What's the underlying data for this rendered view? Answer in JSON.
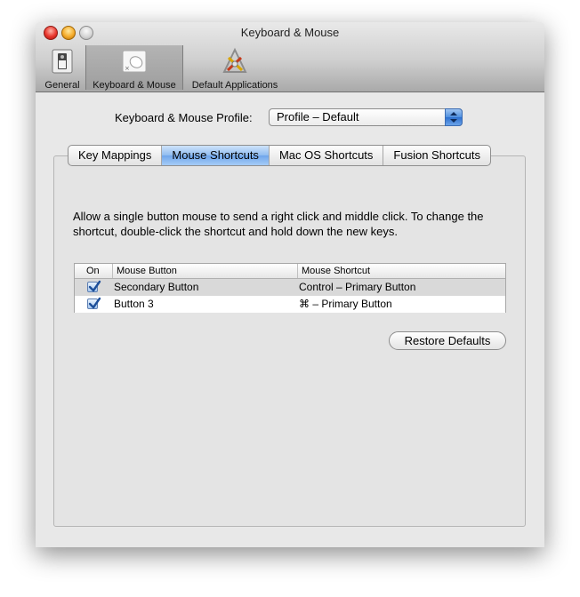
{
  "window": {
    "title": "Keyboard & Mouse"
  },
  "toolbar": {
    "items": [
      {
        "label": "General",
        "icon": "general-switch-icon",
        "selected": false
      },
      {
        "label": "Keyboard & Mouse",
        "icon": "mouse-icon",
        "selected": true
      },
      {
        "label": "Default Applications",
        "icon": "applications-icon",
        "selected": false
      }
    ]
  },
  "profile": {
    "label": "Keyboard & Mouse Profile:",
    "value": "Profile – Default"
  },
  "tabs": [
    {
      "label": "Key Mappings",
      "active": false
    },
    {
      "label": "Mouse Shortcuts",
      "active": true
    },
    {
      "label": "Mac OS Shortcuts",
      "active": false
    },
    {
      "label": "Fusion Shortcuts",
      "active": false
    }
  ],
  "description": "Allow a single button mouse to send a right click and middle click. To change the shortcut, double-click the shortcut and hold down the new keys.",
  "table": {
    "columns": [
      "On",
      "Mouse Button",
      "Mouse Shortcut"
    ],
    "rows": [
      {
        "on": true,
        "button": "Secondary Button",
        "shortcut": "Control – Primary Button"
      },
      {
        "on": true,
        "button": "Button 3",
        "shortcut": "⌘ – Primary Button"
      }
    ]
  },
  "restore_label": "Restore Defaults",
  "colors": {
    "accent": "#6fa6ec",
    "checkmark": "#1d4f9a"
  }
}
